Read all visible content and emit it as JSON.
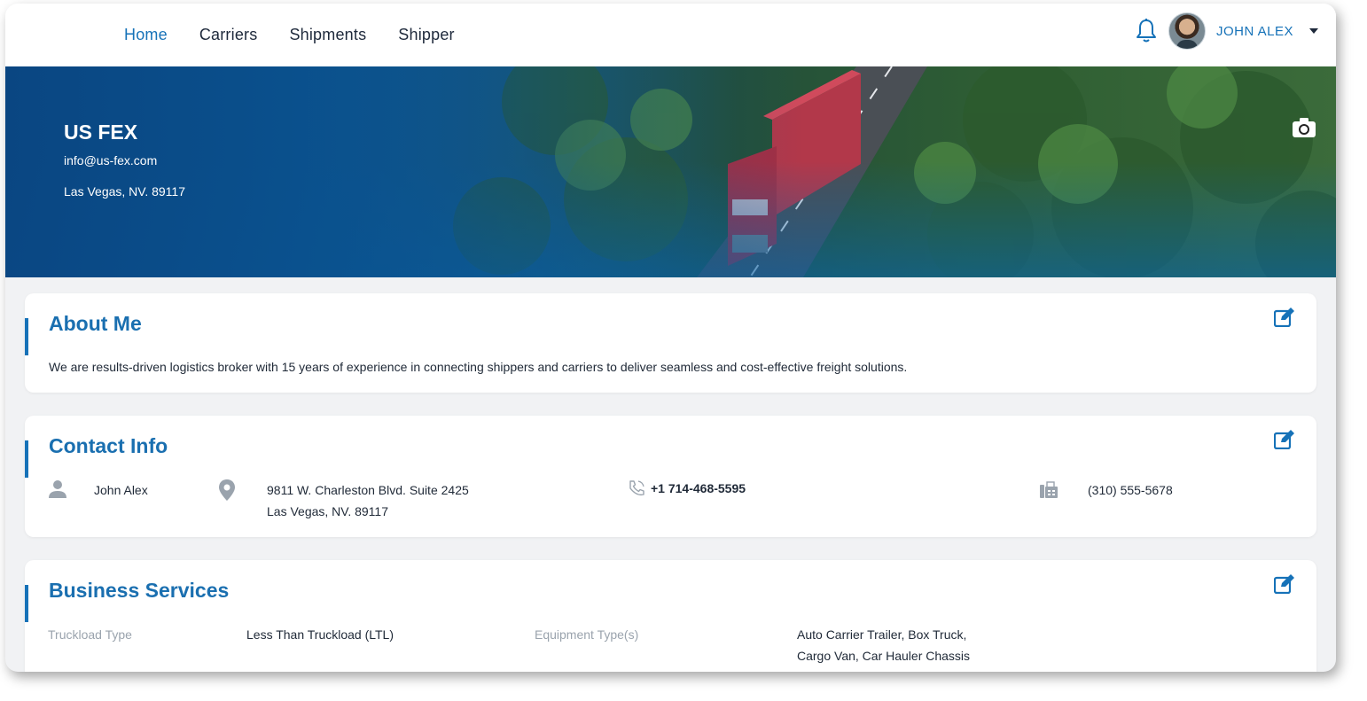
{
  "nav": {
    "links": [
      "Home",
      "Carriers",
      "Shipments",
      "Shipper"
    ],
    "active": "Home",
    "user_name": "JOHN ALEX"
  },
  "hero": {
    "company": "US FEX",
    "email": "info@us-fex.com",
    "location": "Las Vegas, NV. 89117"
  },
  "about": {
    "title": "About Me",
    "text": "We are results-driven logistics broker with 15 years of experience in connecting shippers and carriers to deliver seamless and cost-effective freight solutions."
  },
  "contact": {
    "title": "Contact Info",
    "name": "John Alex",
    "address_line1": "9811 W. Charleston Blvd. Suite 2425",
    "address_line2": "Las Vegas, NV. 89117",
    "phone": "+1 714-468-5595",
    "fax": "(310) 555-5678"
  },
  "business": {
    "title": "Business Services",
    "truckload_label": "Truckload Type",
    "truckload_value": "Less Than Truckload (LTL)",
    "equipment_label": "Equipment Type(s)",
    "equipment_line1": "Auto Carrier Trailer, Box Truck,",
    "equipment_line2": "Cargo Van, Car Hauler Chassis"
  },
  "colors": {
    "accent": "#1672b8",
    "muted": "#9aa3ad"
  },
  "icons": [
    "bell-icon",
    "camera-icon",
    "edit-icon",
    "user-icon",
    "location-pin-icon",
    "phone-icon",
    "fax-icon"
  ]
}
